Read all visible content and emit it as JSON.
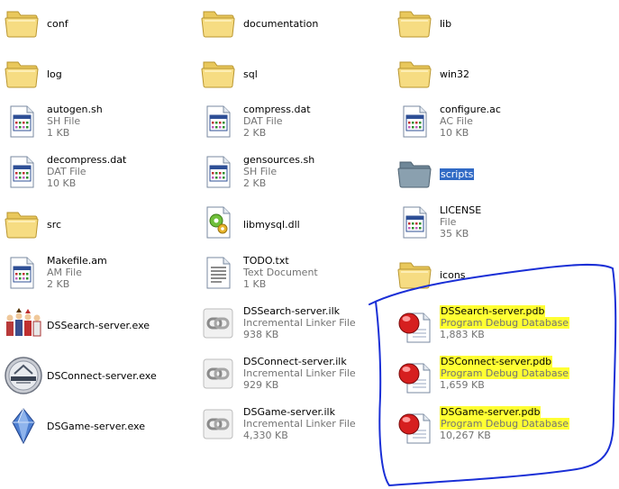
{
  "files": [
    {
      "id": "conf",
      "name": "conf",
      "type": "",
      "size": "",
      "icon": "folder-icon",
      "selected": false,
      "highlight": false
    },
    {
      "id": "documentation",
      "name": "documentation",
      "type": "",
      "size": "",
      "icon": "folder-icon",
      "selected": false,
      "highlight": false
    },
    {
      "id": "lib",
      "name": "lib",
      "type": "",
      "size": "",
      "icon": "folder-icon",
      "selected": false,
      "highlight": false
    },
    {
      "id": "log",
      "name": "log",
      "type": "",
      "size": "",
      "icon": "folder-icon",
      "selected": false,
      "highlight": false
    },
    {
      "id": "sql",
      "name": "sql",
      "type": "",
      "size": "",
      "icon": "folder-icon",
      "selected": false,
      "highlight": false
    },
    {
      "id": "win32",
      "name": "win32",
      "type": "",
      "size": "",
      "icon": "folder-icon",
      "selected": false,
      "highlight": false
    },
    {
      "id": "autogen",
      "name": "autogen.sh",
      "type": "SH File",
      "size": "1 KB",
      "icon": "generic-file-icon",
      "selected": false,
      "highlight": false
    },
    {
      "id": "compress",
      "name": "compress.dat",
      "type": "DAT File",
      "size": "2 KB",
      "icon": "generic-file-icon",
      "selected": false,
      "highlight": false
    },
    {
      "id": "configure",
      "name": "configure.ac",
      "type": "AC File",
      "size": "10 KB",
      "icon": "generic-file-icon",
      "selected": false,
      "highlight": false
    },
    {
      "id": "decompress",
      "name": "decompress.dat",
      "type": "DAT File",
      "size": "10 KB",
      "icon": "generic-file-icon",
      "selected": false,
      "highlight": false
    },
    {
      "id": "gensources",
      "name": "gensources.sh",
      "type": "SH File",
      "size": "2 KB",
      "icon": "generic-file-icon",
      "selected": false,
      "highlight": false
    },
    {
      "id": "scripts",
      "name": "scripts",
      "type": "",
      "size": "",
      "icon": "folder-selected-icon",
      "selected": true,
      "highlight": false
    },
    {
      "id": "src",
      "name": "src",
      "type": "",
      "size": "",
      "icon": "folder-icon",
      "selected": false,
      "highlight": false
    },
    {
      "id": "libmysql",
      "name": "libmysql.dll",
      "type": "",
      "size": "",
      "icon": "dll-file-icon",
      "selected": false,
      "highlight": false
    },
    {
      "id": "license",
      "name": "LICENSE",
      "type": "File",
      "size": "35 KB",
      "icon": "generic-file-icon",
      "selected": false,
      "highlight": false
    },
    {
      "id": "makefile",
      "name": "Makefile.am",
      "type": "AM File",
      "size": "2 KB",
      "icon": "generic-file-icon",
      "selected": false,
      "highlight": false
    },
    {
      "id": "todo",
      "name": "TODO.txt",
      "type": "Text Document",
      "size": "1 KB",
      "icon": "text-document-icon",
      "selected": false,
      "highlight": false
    },
    {
      "id": "icons",
      "name": "icons",
      "type": "",
      "size": "",
      "icon": "folder-icon",
      "selected": false,
      "highlight": false
    },
    {
      "id": "dssearch-exe",
      "name": "DSSearch-server.exe",
      "type": "",
      "size": "",
      "icon": "party-characters-icon",
      "selected": false,
      "highlight": false
    },
    {
      "id": "dssearch-ilk",
      "name": "DSSearch-server.ilk",
      "type": "Incremental Linker File",
      "size": "938 KB",
      "icon": "chain-link-icon",
      "selected": false,
      "highlight": false
    },
    {
      "id": "dssearch-pdb",
      "name": "DSSearch-server.pdb",
      "type": "Program Debug Database",
      "size": "1,883 KB",
      "icon": "debug-database-icon",
      "selected": false,
      "highlight": true
    },
    {
      "id": "dsconnect-exe",
      "name": "DSConnect-server.exe",
      "type": "",
      "size": "",
      "icon": "final-fantasy-emblem-icon",
      "selected": false,
      "highlight": false
    },
    {
      "id": "dsconnect-ilk",
      "name": "DSConnect-server.ilk",
      "type": "Incremental Linker File",
      "size": "929 KB",
      "icon": "chain-link-icon",
      "selected": false,
      "highlight": false
    },
    {
      "id": "dsconnect-pdb",
      "name": "DSConnect-server.pdb",
      "type": "Program Debug Database",
      "size": "1,659 KB",
      "icon": "debug-database-icon",
      "selected": false,
      "highlight": true
    },
    {
      "id": "dsgame-exe",
      "name": "DSGame-server.exe",
      "type": "",
      "size": "",
      "icon": "blue-crystal-icon",
      "selected": false,
      "highlight": false
    },
    {
      "id": "dsgame-ilk",
      "name": "DSGame-server.ilk",
      "type": "Incremental Linker File",
      "size": "4,330 KB",
      "icon": "chain-link-icon",
      "selected": false,
      "highlight": false
    },
    {
      "id": "dsgame-pdb",
      "name": "DSGame-server.pdb",
      "type": "Program Debug Database",
      "size": "10,267 KB",
      "icon": "debug-database-icon",
      "selected": false,
      "highlight": true
    }
  ],
  "colors": {
    "highlight_marker": "#ffff33",
    "annotation_loop": "#1a2fd6",
    "selection": "#316ac5",
    "secondary_text": "#737373"
  }
}
